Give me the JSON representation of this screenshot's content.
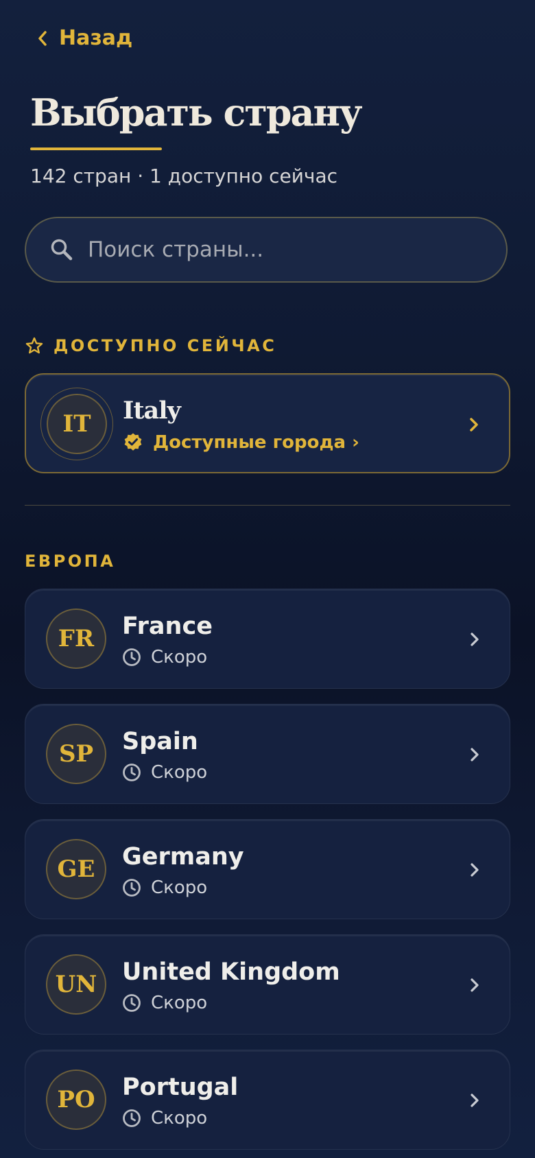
{
  "nav": {
    "back_label": "Назад"
  },
  "header": {
    "title": "Выбрать страну",
    "subtitle": "142 стран · 1 доступно сейчас"
  },
  "search": {
    "placeholder": "Поиск страны...",
    "value": ""
  },
  "available_section": {
    "label": "ДОСТУПНО СЕЙЧАС",
    "items": [
      {
        "code": "IT",
        "name": "Italy",
        "status": "Доступные города ›"
      }
    ]
  },
  "europe_section": {
    "label": "ЕВРОПА",
    "items": [
      {
        "code": "FR",
        "name": "France",
        "status": "Скоро"
      },
      {
        "code": "SP",
        "name": "Spain",
        "status": "Скоро"
      },
      {
        "code": "GE",
        "name": "Germany",
        "status": "Скоро"
      },
      {
        "code": "UN",
        "name": "United Kingdom",
        "status": "Скоро"
      },
      {
        "code": "PO",
        "name": "Portugal",
        "status": "Скоро"
      }
    ]
  },
  "colors": {
    "accent": "#e1b53a",
    "background": "#0f1a33",
    "card": "#15213f",
    "text": "#efeeea",
    "muted": "#cfd2d8"
  }
}
